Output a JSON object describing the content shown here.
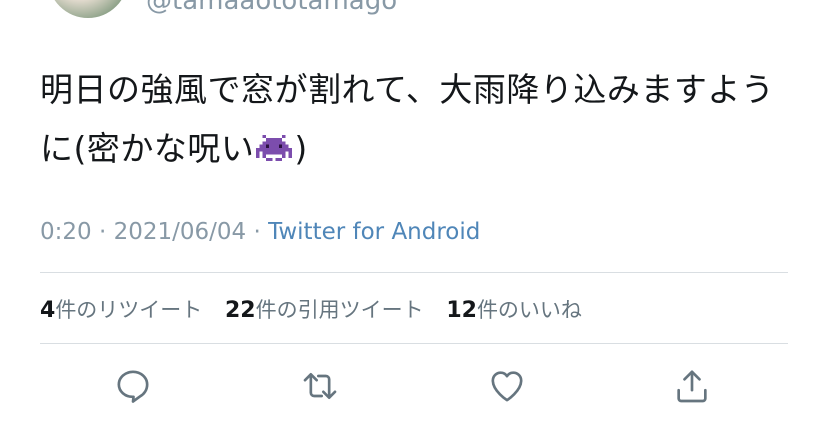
{
  "author": {
    "handle": "@tamaaototamago"
  },
  "tweet": {
    "text_part1": "明日の強風で窓が割れて、大雨降り込みますように(密かな呪い",
    "text_part2": ")",
    "emoji_icon": "alien-monster-icon",
    "time": "0:20",
    "date": "2021/06/04",
    "separator": " · ",
    "source": "Twitter for Android"
  },
  "stats": {
    "retweets_count": "4",
    "retweets_label": "件のリツイート",
    "quotes_count": "22",
    "quotes_label": "件の引用ツイート",
    "likes_count": "12",
    "likes_label": "件のいいね"
  },
  "actions": [
    {
      "name": "reply",
      "icon": "reply-icon"
    },
    {
      "name": "retweet",
      "icon": "retweet-icon"
    },
    {
      "name": "like",
      "icon": "heart-icon"
    },
    {
      "name": "share",
      "icon": "share-icon"
    }
  ],
  "colors": {
    "text": "#14171a",
    "muted": "#8899a6",
    "link": "#4f86b8",
    "divider": "#d9dee2",
    "icon": "#66757f",
    "emoji": "#7c4dad"
  }
}
